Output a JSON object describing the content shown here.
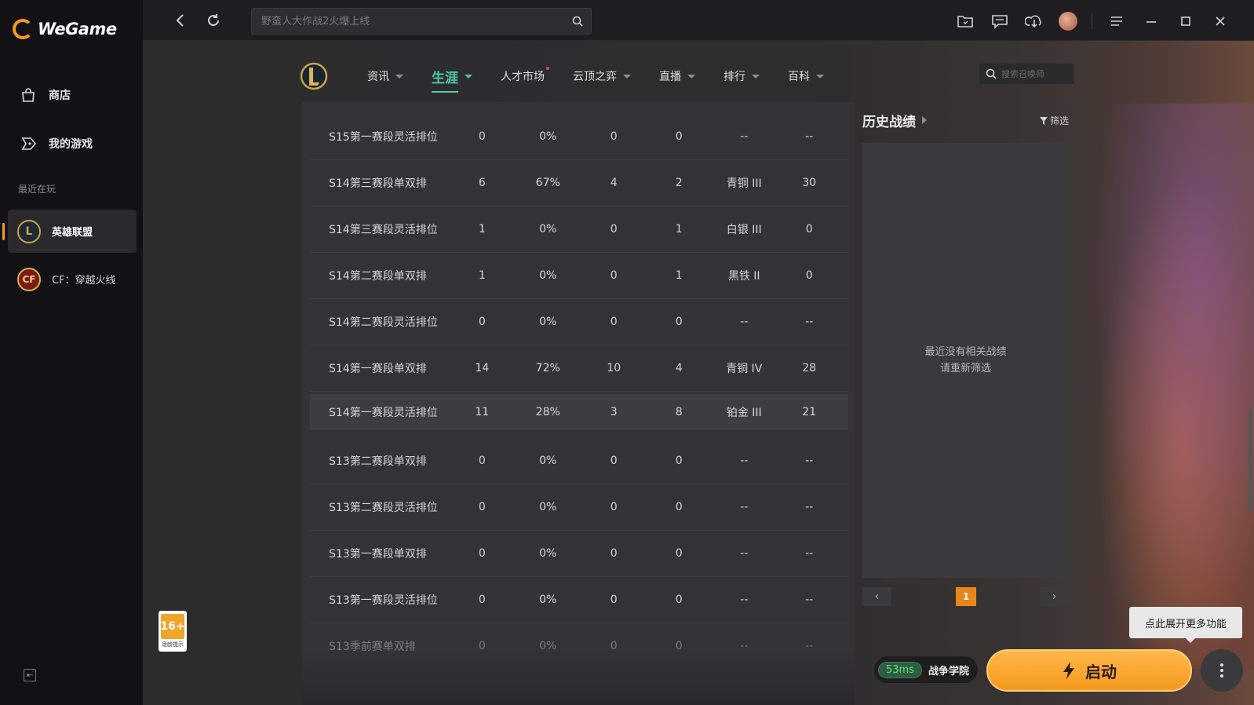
{
  "app": {
    "name": "WeGame"
  },
  "sidebar": {
    "items": [
      {
        "label": "商店",
        "icon": "store-bag-icon"
      },
      {
        "label": "我的游戏",
        "icon": "gamepad-icon"
      }
    ],
    "recent_label": "最近在玩",
    "games": [
      {
        "label": "英雄联盟",
        "active": true
      },
      {
        "label": "CF：穿越火线",
        "active": false
      }
    ]
  },
  "topbar": {
    "search_placeholder": "野蛮人大作战2火爆上线"
  },
  "game_nav": {
    "tabs": [
      {
        "label": "资讯",
        "active": false
      },
      {
        "label": "生涯",
        "active": true
      },
      {
        "label": "人才市场",
        "active": false,
        "dot": true
      },
      {
        "label": "云顶之弈",
        "active": false
      },
      {
        "label": "直播",
        "active": false
      },
      {
        "label": "排行",
        "active": false
      },
      {
        "label": "百科",
        "active": false
      }
    ],
    "summoner_search_placeholder": "搜索召唤师"
  },
  "rank_table": {
    "rows": [
      [
        "S15第一赛段灵活排位",
        "0",
        "0%",
        "0",
        "0",
        "--",
        "--"
      ],
      [
        "S14第三赛段单双排",
        "6",
        "67%",
        "4",
        "2",
        "青铜 III",
        "30"
      ],
      [
        "S14第三赛段灵活排位",
        "1",
        "0%",
        "0",
        "1",
        "白银 III",
        "0"
      ],
      [
        "S14第二赛段单双排",
        "1",
        "0%",
        "0",
        "1",
        "黑铁 II",
        "0"
      ],
      [
        "S14第二赛段灵活排位",
        "0",
        "0%",
        "0",
        "0",
        "--",
        "--"
      ],
      [
        "S14第一赛段单双排",
        "14",
        "72%",
        "10",
        "4",
        "青铜 IV",
        "28"
      ],
      [
        "S14第一赛段灵活排位",
        "11",
        "28%",
        "3",
        "8",
        "铂金 III",
        "21"
      ],
      [
        "S13第二赛段单双排",
        "0",
        "0%",
        "0",
        "0",
        "--",
        "--"
      ],
      [
        "S13第二赛段灵活排位",
        "0",
        "0%",
        "0",
        "0",
        "--",
        "--"
      ],
      [
        "S13第一赛段单双排",
        "0",
        "0%",
        "0",
        "0",
        "--",
        "--"
      ],
      [
        "S13第一赛段灵活排位",
        "0",
        "0%",
        "0",
        "0",
        "--",
        "--"
      ],
      [
        "S13季前赛单双排",
        "0",
        "0%",
        "0",
        "0",
        "--",
        "--"
      ]
    ]
  },
  "history": {
    "title": "历史战绩",
    "filter_label": "筛选",
    "empty_line1": "最近没有相关战绩",
    "empty_line2": "请重新筛选",
    "page": "1",
    "prev": "‹",
    "next": "›"
  },
  "bottom": {
    "ping": "53ms",
    "server": "战争学院",
    "launch_label": "启动",
    "tooltip": "点此展开更多功能",
    "age_rating": "16+",
    "age_label": "适龄提示"
  },
  "colors": {
    "accent_orange": "#f39a1e",
    "accent_teal": "#4fc6ae",
    "ping_green": "#5fe08a"
  }
}
